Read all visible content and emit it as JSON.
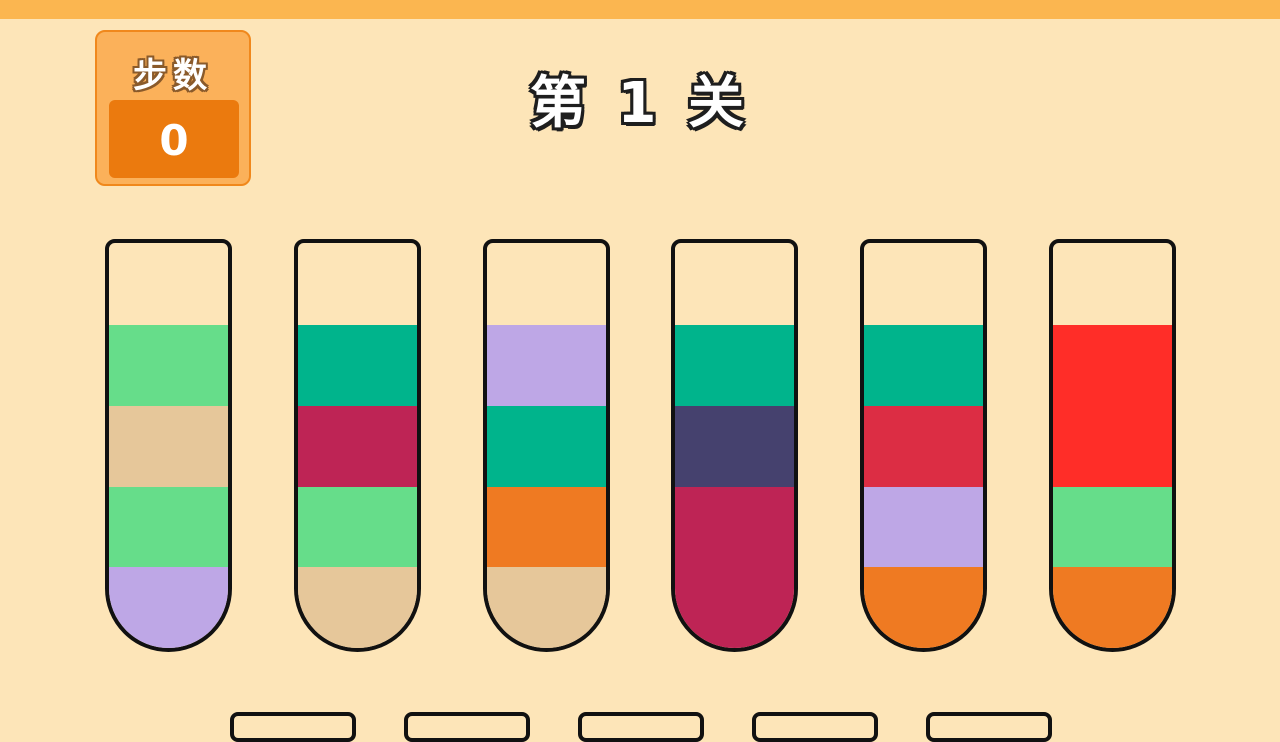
{
  "hud": {
    "moves_label": "步数",
    "moves_value": "0",
    "level_title": "第 1 关"
  },
  "colors": {
    "background": "#FDE5B8",
    "top_bar": "#FBB650",
    "panel": "#FBB15A",
    "panel_value": "#EB7A0E"
  },
  "tubes": [
    {
      "layers": [
        "#66DD8A",
        "#E6C79A",
        "#66DD8A",
        "#BEA7E6"
      ]
    },
    {
      "layers": [
        "#00B48C",
        "#BE2455",
        "#66DD8A",
        "#E6C79A"
      ]
    },
    {
      "layers": [
        "#BEA7E6",
        "#00B48C",
        "#EF7A22",
        "#E6C79A"
      ]
    },
    {
      "layers": [
        "#00B48C",
        "#45416E",
        "#BE2455",
        "#BE2455"
      ]
    },
    {
      "layers": [
        "#00B48C",
        "#DC2D44",
        "#BEA7E6",
        "#EF7A22"
      ]
    },
    {
      "layers": [
        "#FF2D28",
        "#FF2D28",
        "#66DD8A",
        "#EF7A22"
      ]
    }
  ],
  "bottom_slots": [
    {
      "state": "empty"
    },
    {
      "state": "empty"
    },
    {
      "state": "empty"
    },
    {
      "state": "empty"
    },
    {
      "state": "empty"
    }
  ]
}
